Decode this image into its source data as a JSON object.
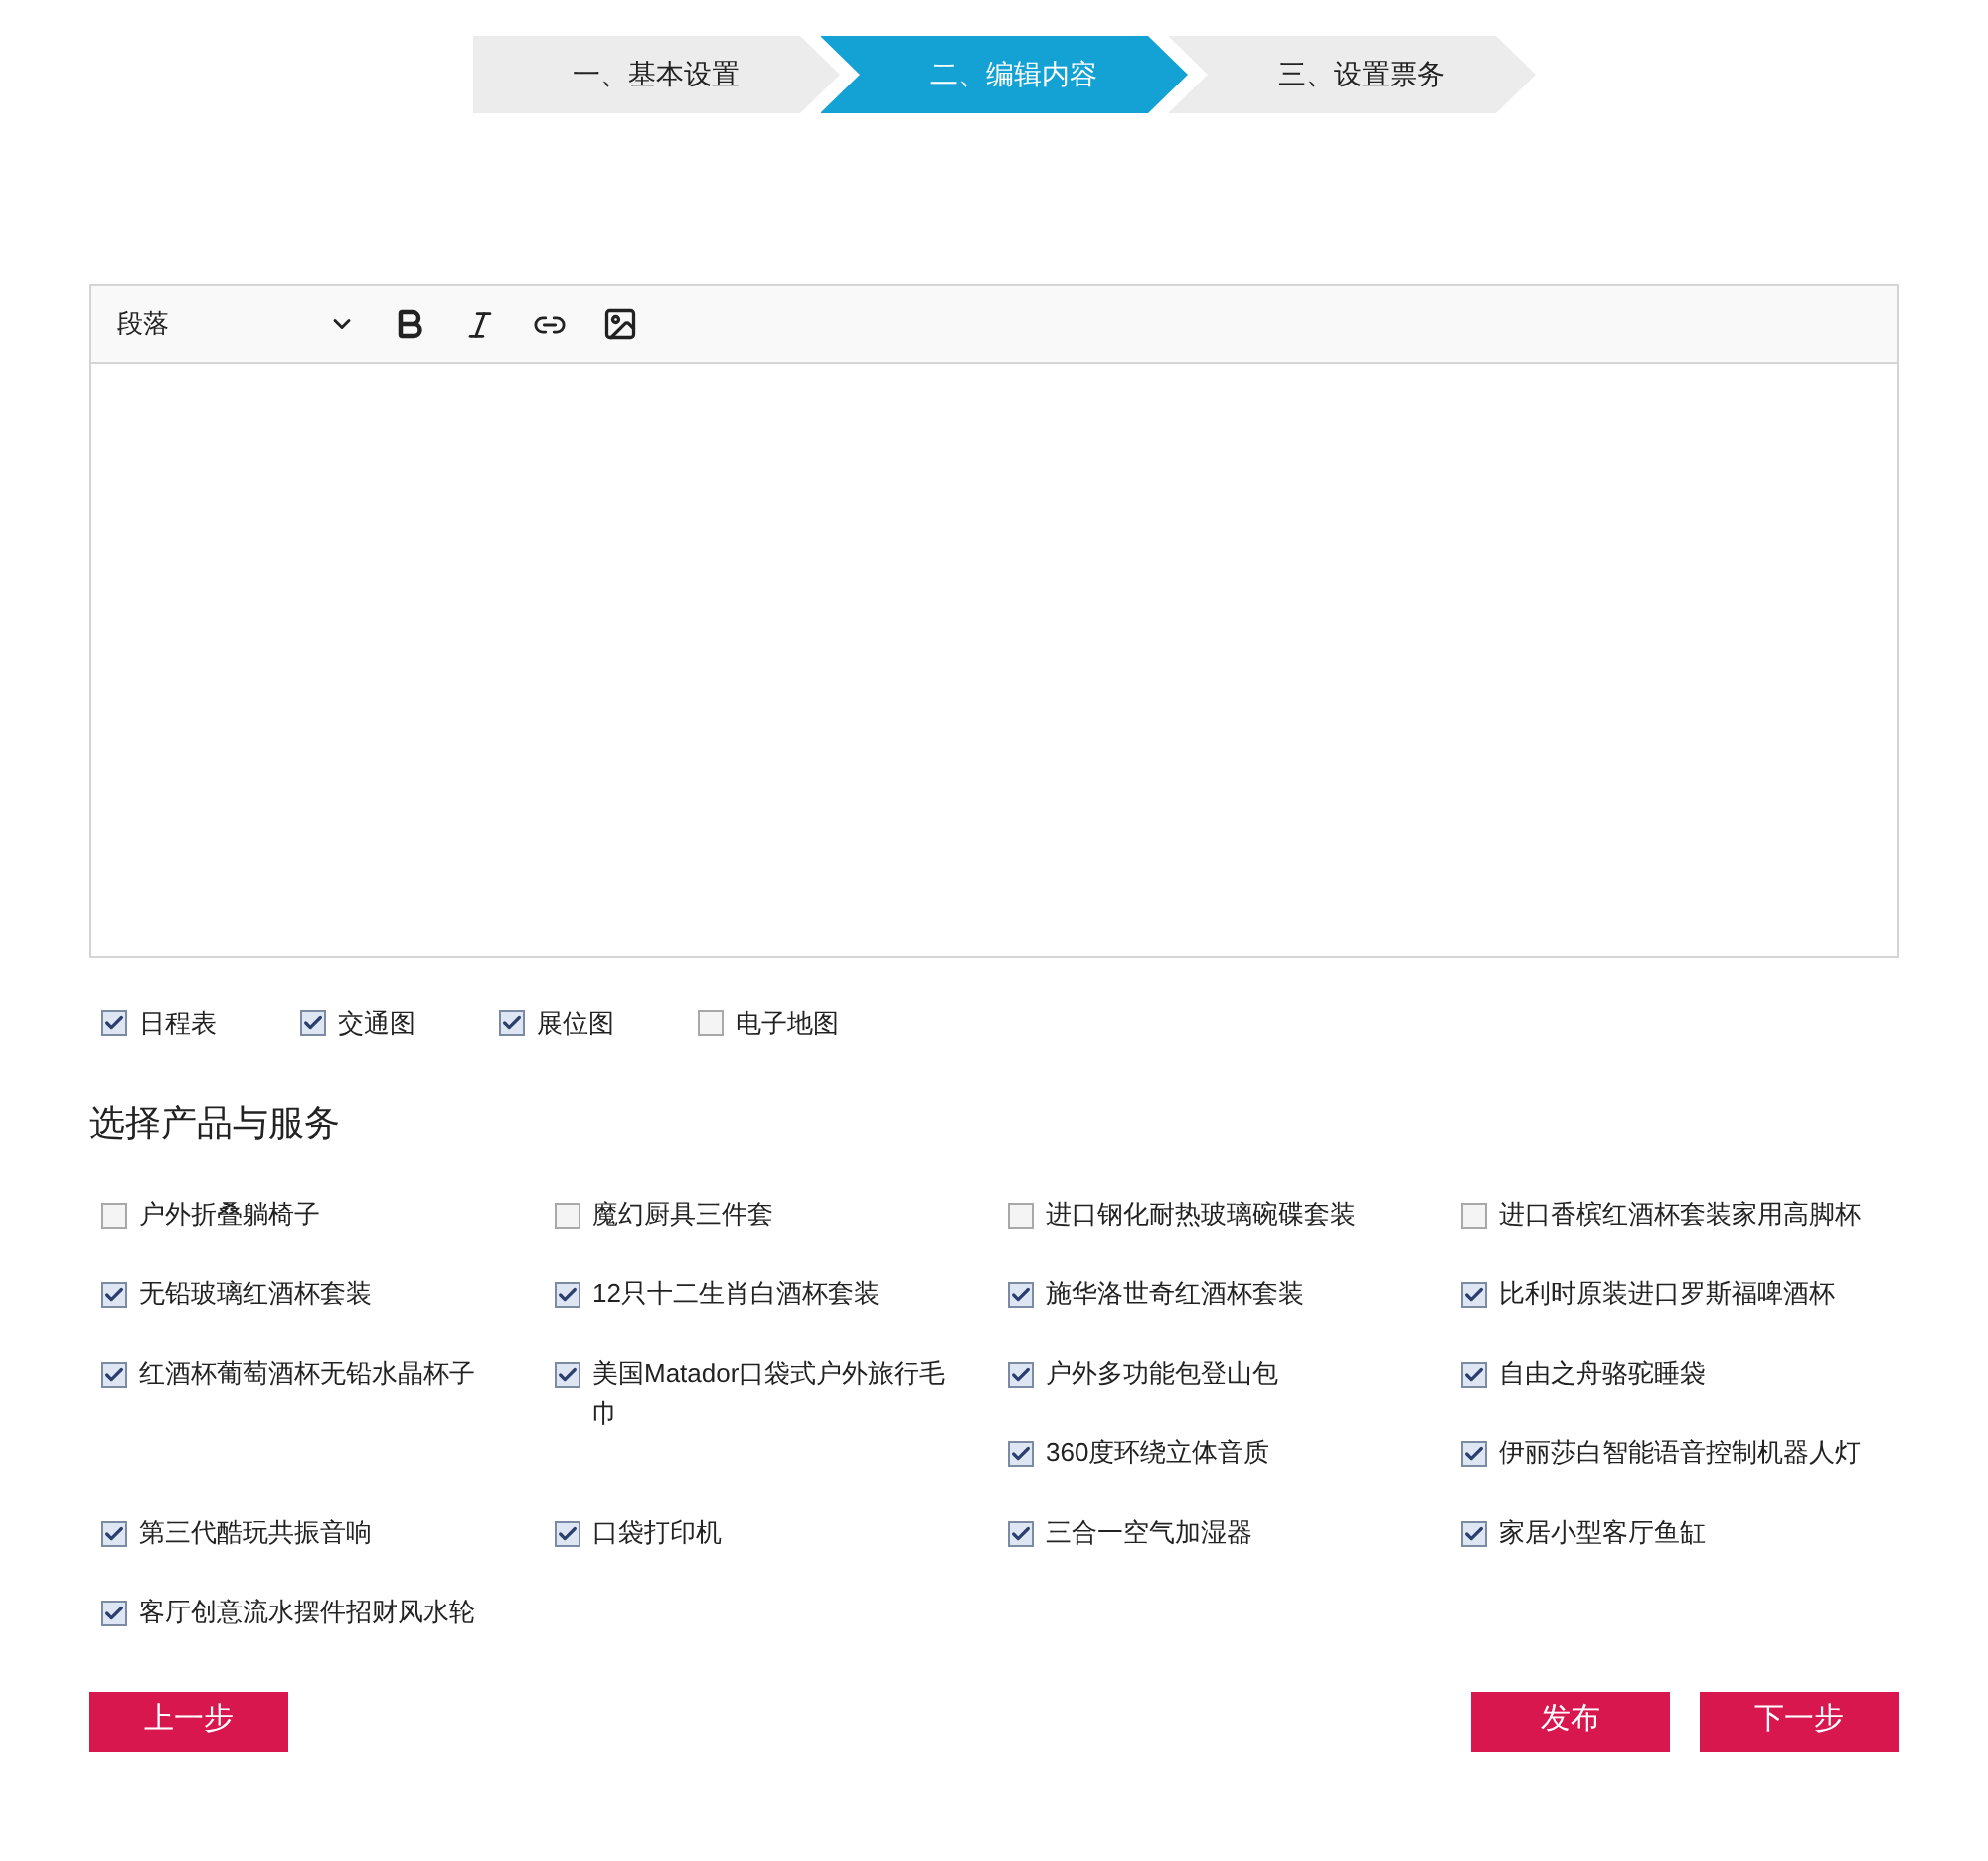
{
  "steps": [
    {
      "label": "一、基本设置",
      "selected": false
    },
    {
      "label": "二、编辑内容",
      "selected": true
    },
    {
      "label": "三、设置票务",
      "selected": false
    }
  ],
  "editor": {
    "format_select": "段落"
  },
  "attachments": [
    {
      "label": "日程表",
      "checked": true
    },
    {
      "label": "交通图",
      "checked": true
    },
    {
      "label": "展位图",
      "checked": true
    },
    {
      "label": "电子地图",
      "checked": false
    }
  ],
  "products": {
    "title": "选择产品与服务",
    "items": [
      {
        "label": "户外折叠躺椅子",
        "checked": false
      },
      {
        "label": "魔幻厨具三件套",
        "checked": false
      },
      {
        "label": "进口钢化耐热玻璃碗碟套装",
        "checked": false
      },
      {
        "label": "进口香槟红酒杯套装家用高脚杯",
        "checked": false
      },
      {
        "label": "无铅玻璃红酒杯套装",
        "checked": true
      },
      {
        "label": "12只十二生肖白酒杯套装",
        "checked": true
      },
      {
        "label": "施华洛世奇红酒杯套装",
        "checked": true
      },
      {
        "label": "比利时原装进口罗斯福啤酒杯",
        "checked": true
      },
      {
        "label": "红酒杯葡萄酒杯无铅水晶杯子",
        "checked": true
      },
      {
        "label": "美国Matador口袋式户外旅行毛巾",
        "checked": true
      },
      {
        "label": "户外多功能包登山包",
        "checked": true
      },
      {
        "label": "自由之舟骆驼睡袋",
        "checked": true
      },
      {
        "label": "360度环绕立体音质",
        "checked": true
      },
      {
        "label": "伊丽莎白智能语音控制机器人灯",
        "checked": true
      },
      {
        "label": "第三代酷玩共振音响",
        "checked": true
      },
      {
        "label": "口袋打印机",
        "checked": true
      },
      {
        "label": "三合一空气加湿器",
        "checked": true
      },
      {
        "label": "家居小型客厅鱼缸",
        "checked": true
      },
      {
        "label": "客厅创意流水摆件招财风水轮",
        "checked": true
      }
    ]
  },
  "buttons": {
    "prev": "上一步",
    "publish": "发布",
    "next": "下一步"
  }
}
